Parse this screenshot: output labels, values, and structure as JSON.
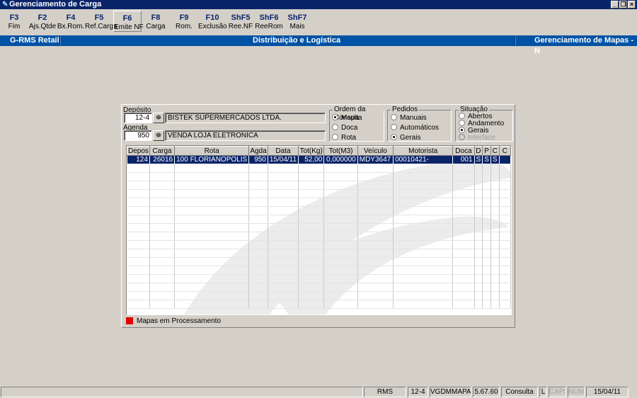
{
  "window": {
    "title": "Gerenciamento de Carga"
  },
  "toolbar": [
    {
      "key": "F3",
      "label": "Fim"
    },
    {
      "key": "F2",
      "label": "Ajs.Qtde"
    },
    {
      "key": "F4",
      "label": "Bx.Rom."
    },
    {
      "key": "F5",
      "label": "Ref.Carga"
    },
    {
      "key": "F6",
      "label": "Emite NF"
    },
    {
      "key": "F8",
      "label": "Carga"
    },
    {
      "key": "F9",
      "label": "Rom."
    },
    {
      "key": "F10",
      "label": "Exclusão"
    },
    {
      "key": "ShF5",
      "label": "Ree.NF"
    },
    {
      "key": "ShF6",
      "label": "ReeRom"
    },
    {
      "key": "ShF7",
      "label": "Mais"
    }
  ],
  "banner": {
    "left": "G-RMS Retail",
    "center": "Distribuição e Logística",
    "right": "Gerenciamento de Mapas - N"
  },
  "filters": {
    "deposito": {
      "label": "Depósito",
      "code": "12-4",
      "name": "BISTEK SUPERMERCADOS LTDA."
    },
    "agenda": {
      "label": "Agenda",
      "code": "950",
      "name": "VENDA LOJA ELETRONICA"
    }
  },
  "ordem": {
    "title": "Ordem da Consulta",
    "options": [
      "Mapa",
      "Doca",
      "Rota"
    ],
    "selected": "Mapa"
  },
  "pedidos": {
    "title": "Pedidos",
    "options": [
      "Manuais",
      "Automáticos",
      "Gerais"
    ],
    "selected": "Gerais"
  },
  "situacao": {
    "title": "Situação",
    "options": [
      "Abertos",
      "Andamento",
      "Gerais",
      "Interface"
    ],
    "selected": "Gerais",
    "disabled": "Interface"
  },
  "grid": {
    "columns": [
      "Depos",
      "Carga",
      "Rota",
      "Agda",
      "Data",
      "Tot(Kg)",
      "Tot(M3)",
      "Veículo",
      "Motorista",
      "Doca",
      "D",
      "P",
      "C",
      "C"
    ],
    "rows": [
      [
        "124",
        "26016",
        "100 FLORIANOPOLIS",
        "950",
        "15/04/11",
        "52,00",
        "0,000000",
        "MDY3647",
        "00010421-",
        "001",
        "S",
        "S",
        "S",
        ""
      ]
    ]
  },
  "legend": {
    "label": "Mapas em Processamento",
    "color": "#e00000"
  },
  "status": {
    "fields": [
      "RMS",
      "12-4",
      "VGDMMAPA",
      "5.67.60",
      "Consulta",
      "L",
      "CAPS",
      "NUM",
      "15/04/11"
    ]
  }
}
